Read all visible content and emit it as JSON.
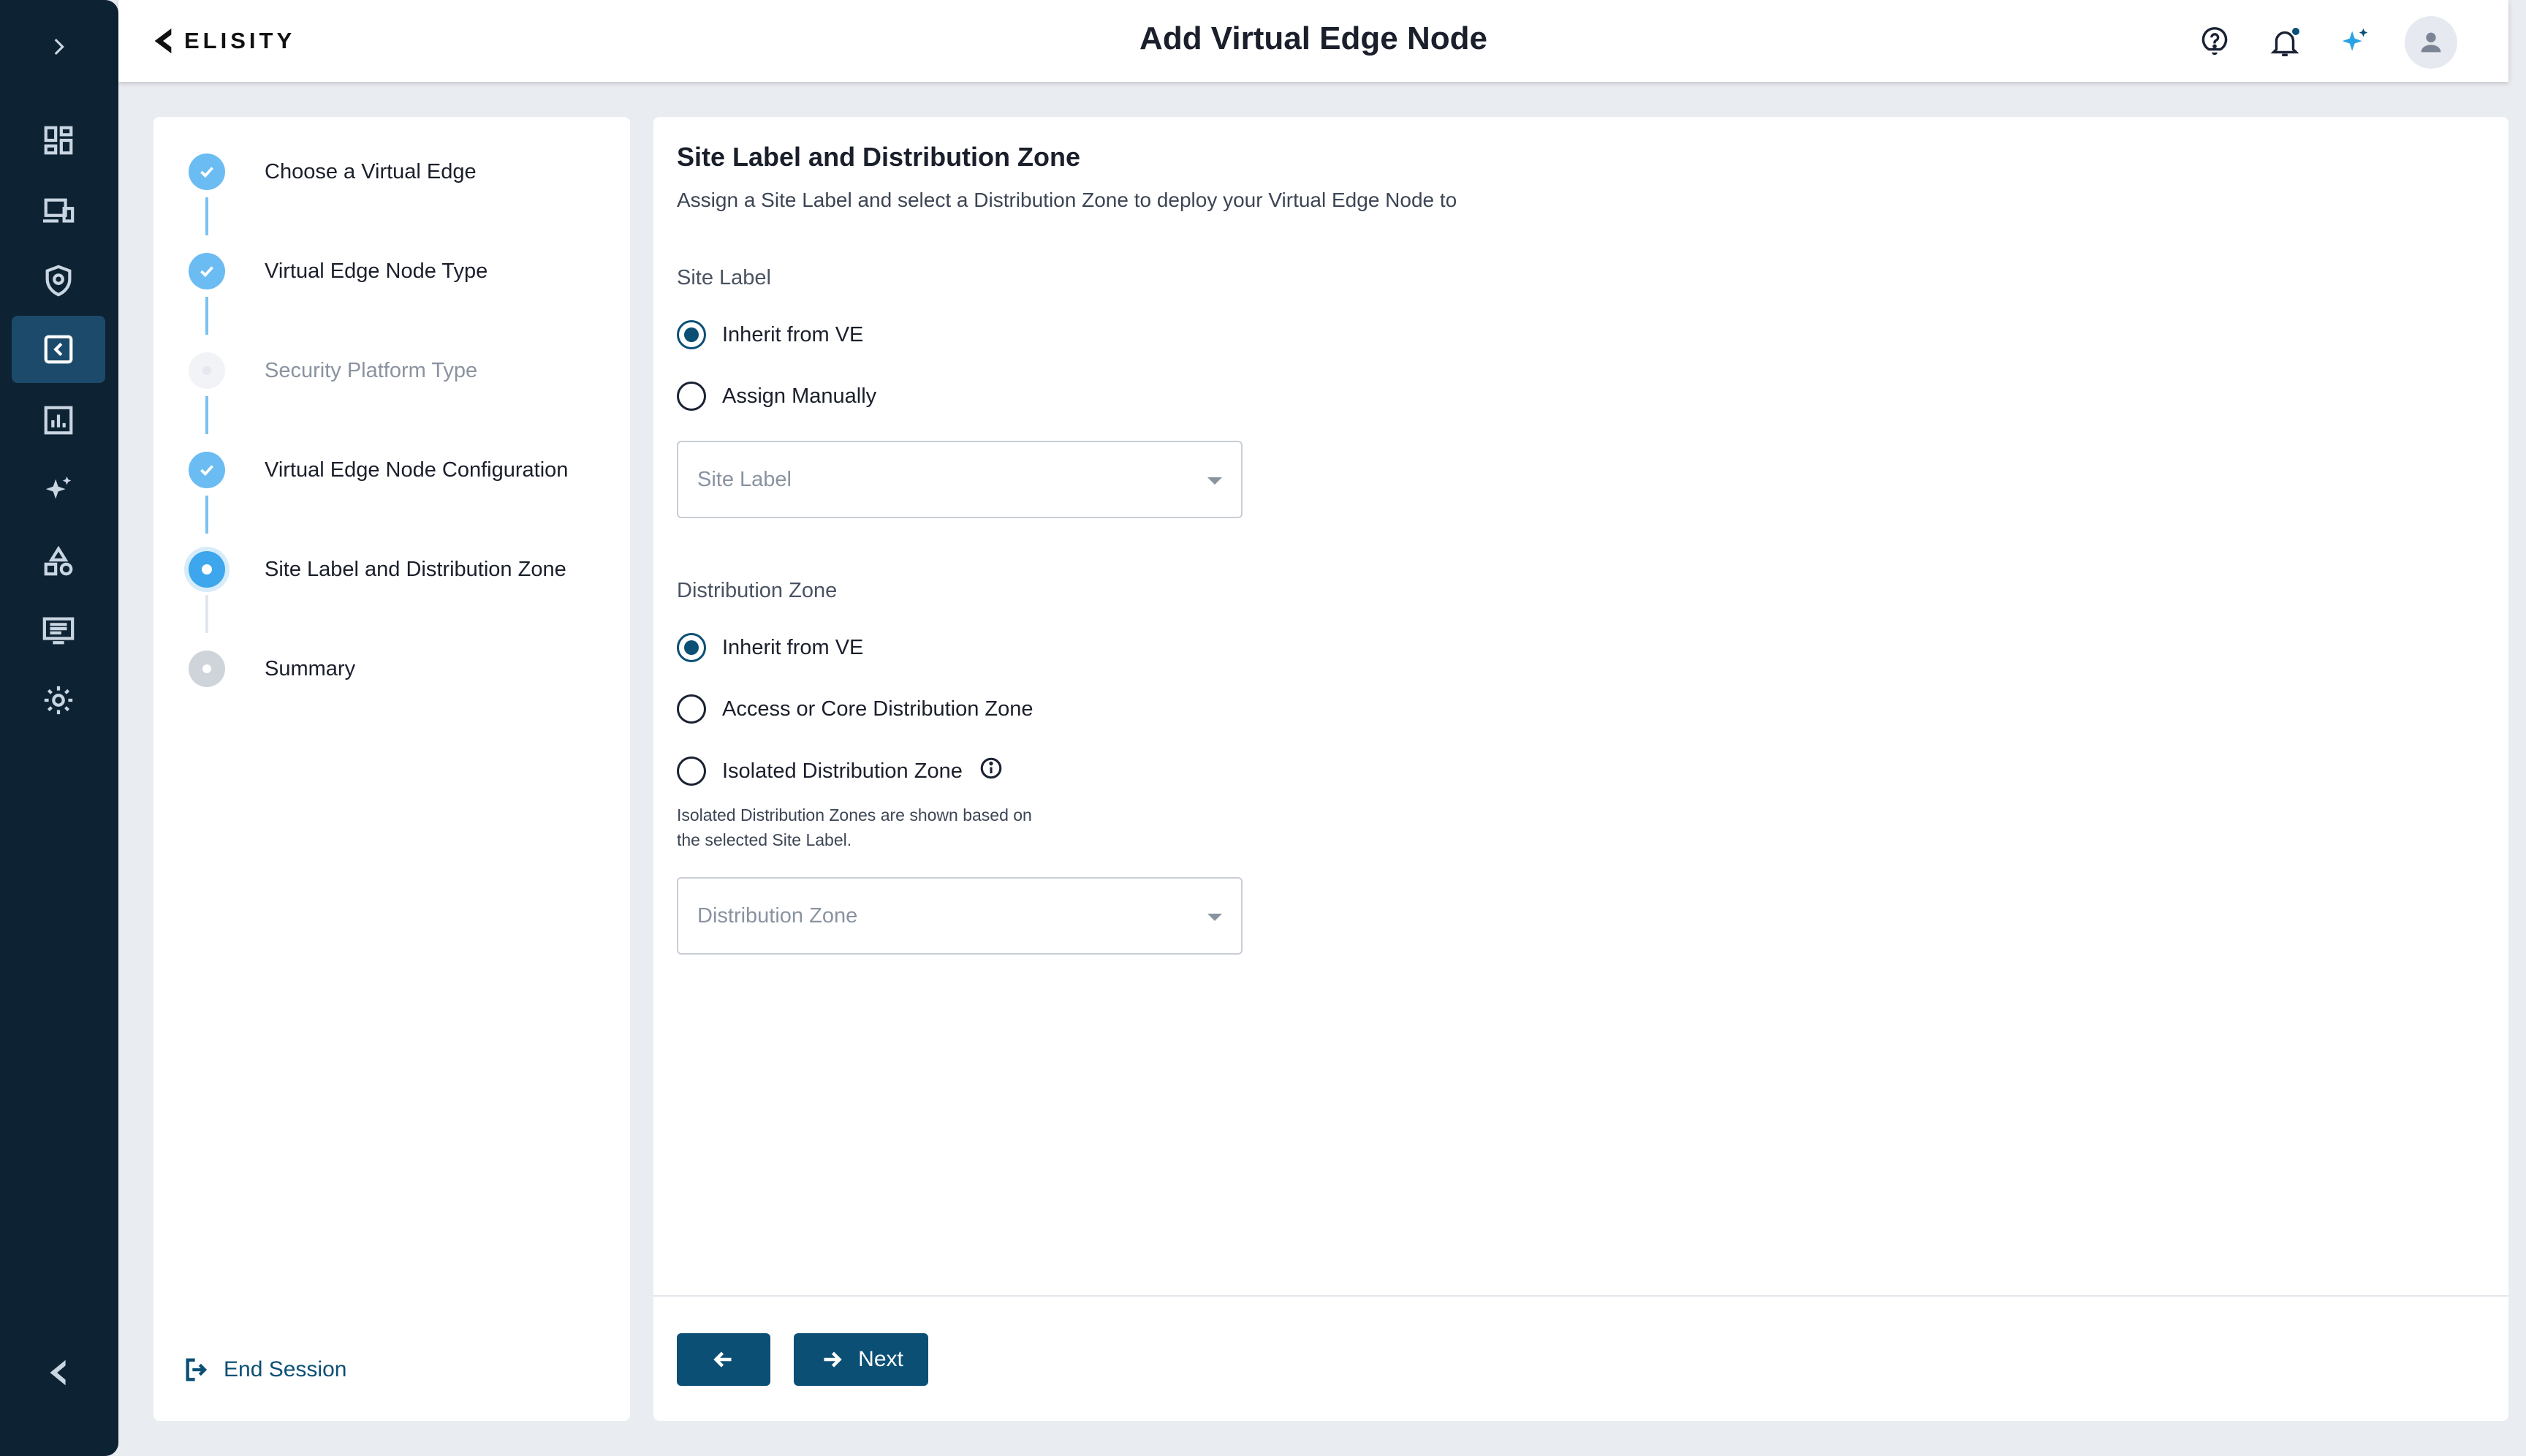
{
  "header": {
    "logo_text": "ELISITY",
    "title": "Add Virtual Edge Node",
    "icons": [
      "help-icon",
      "bell-icon",
      "sparkle-icon",
      "user-avatar-icon"
    ]
  },
  "nav": {
    "items": [
      "expand-icon",
      "dashboard-icon",
      "devices-icon",
      "shield-icon",
      "virtual-edge-icon",
      "analytics-icon",
      "ai-sparkle-icon",
      "shapes-icon",
      "logs-icon",
      "settings-icon",
      "elisity-logo-icon"
    ],
    "active": "virtual-edge-icon"
  },
  "stepper": {
    "steps": [
      {
        "label": "Choose a Virtual Edge",
        "status": "done"
      },
      {
        "label": "Virtual Edge Node Type",
        "status": "done"
      },
      {
        "label": "Security Platform Type",
        "status": "disabled"
      },
      {
        "label": "Virtual Edge Node Configuration",
        "status": "done"
      },
      {
        "label": "Site Label and Distribution Zone",
        "status": "current"
      },
      {
        "label": "Summary",
        "status": "pending"
      }
    ],
    "end_session": "End Session"
  },
  "form": {
    "title": "Site Label and Distribution Zone",
    "subtitle": "Assign a Site Label and select a Distribution Zone to deploy your Virtual Edge Node to",
    "site_label": {
      "heading": "Site Label",
      "options": [
        "Inherit from VE",
        "Assign Manually"
      ],
      "selected": "Inherit from VE",
      "select_placeholder": "Site Label"
    },
    "distribution_zone": {
      "heading": "Distribution Zone",
      "options": [
        "Inherit from VE",
        "Access or Core Distribution Zone",
        "Isolated Distribution Zone"
      ],
      "selected": "Inherit from VE",
      "hint": "Isolated Distribution Zones are shown based on the selected Site Label.",
      "select_placeholder": "Distribution Zone"
    }
  },
  "footer": {
    "next_label": "Next"
  },
  "colors": {
    "rail": "#0d2233",
    "primary": "#0b4f75",
    "step_done": "#6bbcf2",
    "step_current": "#3da6ec",
    "sparkle": "#2aa3e6"
  }
}
